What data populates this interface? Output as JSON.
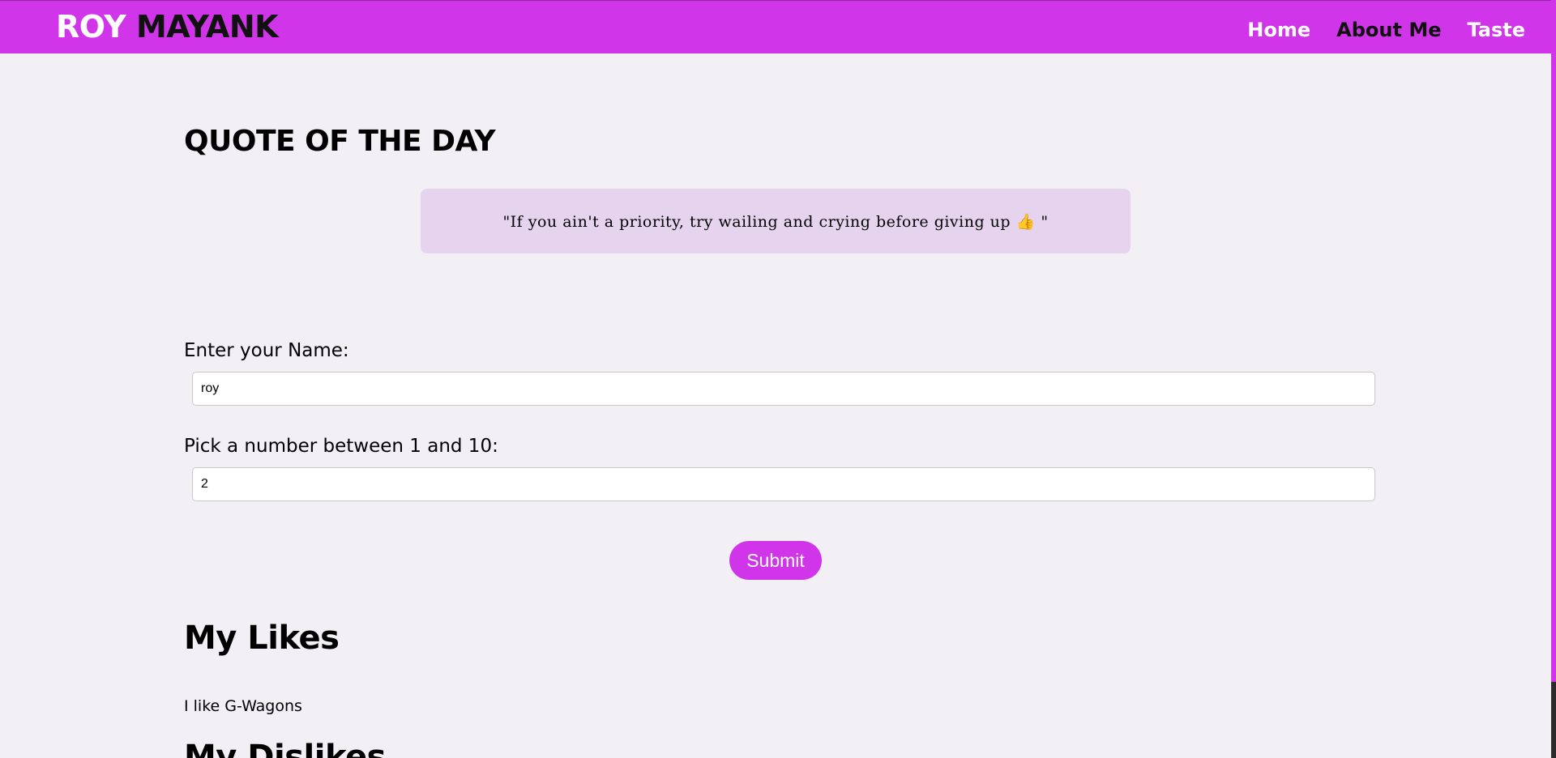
{
  "navbar": {
    "brand_first": "ROY",
    "brand_last": "MAYANK",
    "links": [
      "Home",
      "About Me",
      "Taste"
    ]
  },
  "quote": {
    "heading": "QUOTE OF THE DAY",
    "text": "\"If you ain't a priority, try wailing and crying before giving up 👍 \""
  },
  "form": {
    "name_label": "Enter your Name:",
    "name_value": "roy",
    "number_label": "Pick a number between 1 and 10:",
    "number_value": "2",
    "submit_label": "Submit"
  },
  "likes": {
    "heading": "My Likes",
    "text": "I like G-Wagons"
  },
  "dislikes": {
    "heading": "My Dislikes"
  },
  "colors": {
    "accent": "#d035e9",
    "page_background": "#f2eff5",
    "quote_background": "#e6d4ef"
  }
}
